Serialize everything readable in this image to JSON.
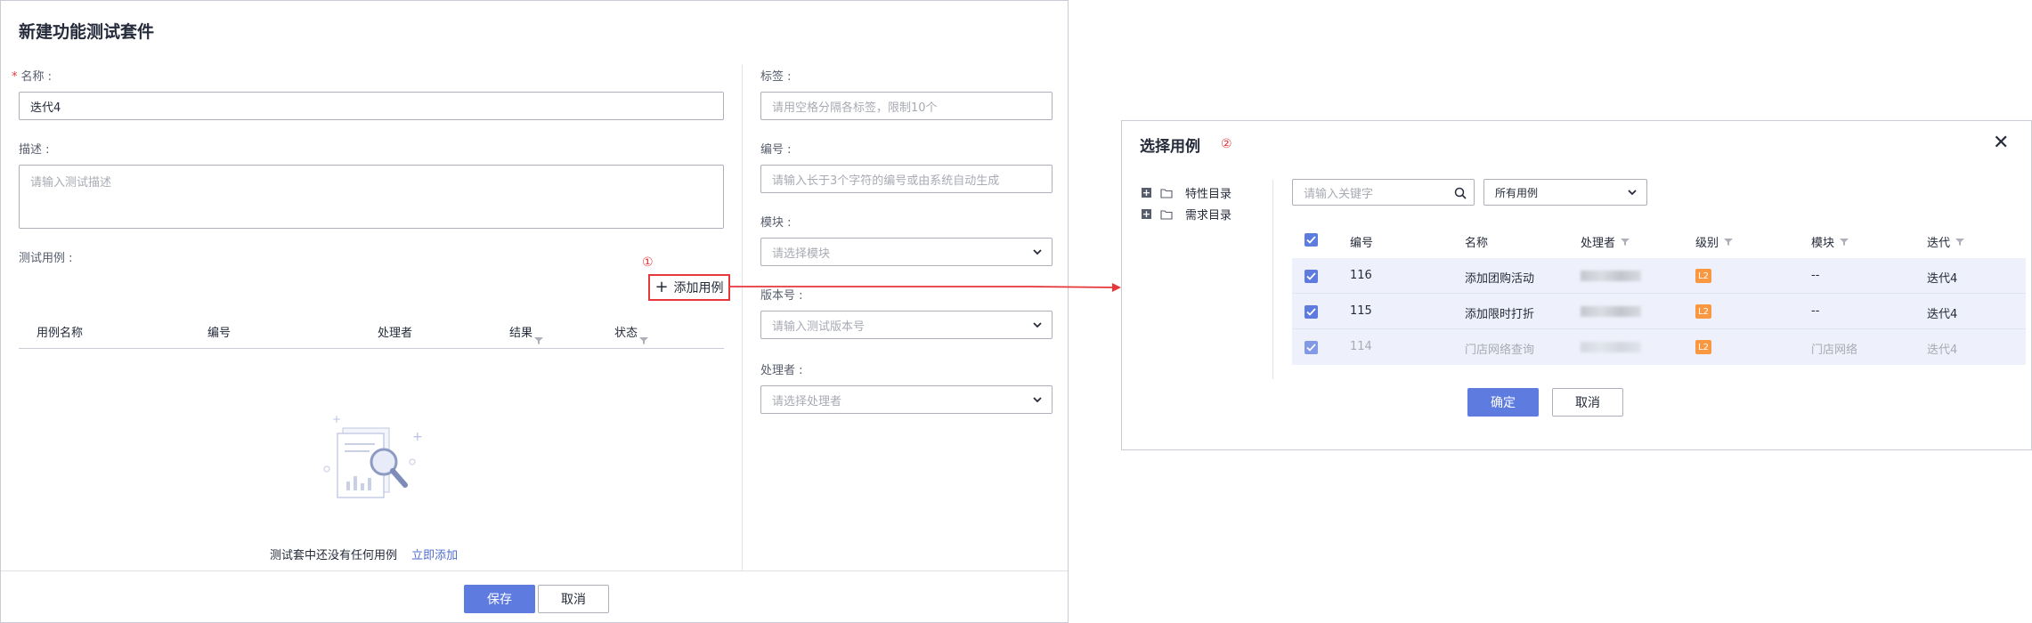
{
  "left": {
    "title": "新建功能测试套件",
    "name_label": "名称 :",
    "name_required_mark": "*",
    "name_value": "迭代4",
    "desc_label": "描述 :",
    "desc_placeholder": "请输入测试描述",
    "cases_label": "测试用例 :",
    "add_marker": "①",
    "add_button": "添加用例",
    "table_headers": [
      "用例名称",
      "编号",
      "处理者",
      "结果",
      "状态"
    ],
    "empty_text": "测试套中还没有任何用例",
    "empty_link": "立即添加",
    "right_fields": [
      {
        "label": "标签 :",
        "placeholder": "请用空格分隔各标签，限制10个",
        "type": "input"
      },
      {
        "label": "编号 :",
        "placeholder": "请输入长于3个字符的编号或由系统自动生成",
        "type": "input"
      },
      {
        "label": "模块 :",
        "placeholder": "请选择模块",
        "type": "select"
      },
      {
        "label": "版本号 :",
        "placeholder": "请输入测试版本号",
        "type": "select"
      },
      {
        "label": "处理者 :",
        "placeholder": "请选择处理者",
        "type": "select"
      }
    ],
    "save_button": "保存",
    "cancel_button": "取消"
  },
  "dialog": {
    "title": "选择用例",
    "marker": "②",
    "tree": [
      "特性目录",
      "需求目录"
    ],
    "search_placeholder": "请输入关键字",
    "filter_select": "所有用例",
    "headers": [
      "编号",
      "名称",
      "处理者",
      "级别",
      "模块",
      "迭代"
    ],
    "rows": [
      {
        "id": "116",
        "name": "添加团购活动",
        "level": "L2",
        "module": "--",
        "iteration": "迭代4",
        "disabled": false
      },
      {
        "id": "115",
        "name": "添加限时打折",
        "level": "L2",
        "module": "--",
        "iteration": "迭代4",
        "disabled": false
      },
      {
        "id": "114",
        "name": "门店网络查询",
        "level": "L2",
        "module": "门店网络",
        "iteration": "迭代4",
        "disabled": true
      }
    ],
    "confirm_button": "确定",
    "cancel_button": "取消"
  },
  "colors": {
    "primary": "#5e7ce0",
    "annotation_red": "#e6383b",
    "level_badge": "#fa9841",
    "link": "#526ecc"
  }
}
